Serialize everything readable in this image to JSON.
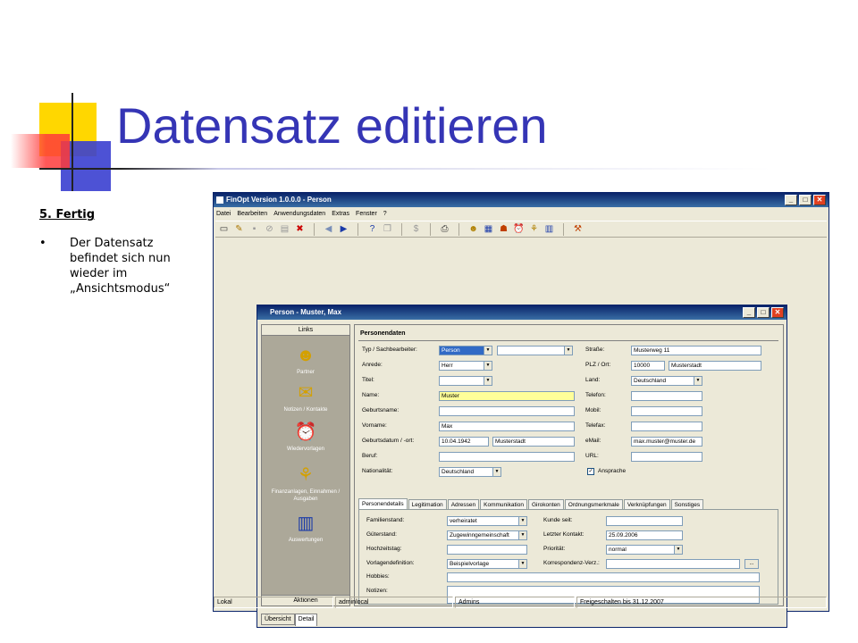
{
  "slide": {
    "title": "Datensatz editieren",
    "step": "5. Fertig",
    "bullet": "•",
    "bullet_text": "Der Datensatz befindet sich nun wieder im „Ansichtsmodus“"
  },
  "app": {
    "title": "FinOpt Version 1.0.0.0 - Person",
    "menu": [
      "Datei",
      "Bearbeiten",
      "Anwendungsdaten",
      "Extras",
      "Fenster",
      "?"
    ],
    "win_minimize": "_",
    "win_maximize": "□",
    "win_close": "✕",
    "status": [
      "Lokal",
      "adminlocal",
      "Admins",
      "Freigeschalten bis 31.12.2007"
    ]
  },
  "inner": {
    "title": "Person - Muster, Max",
    "left_header": "Links",
    "left_footer": "Aktionen",
    "nav": [
      "Partner",
      "Notizen / Kontakte",
      "Wiedervorlagen",
      "Finanzanlagen, Einnahmen / Ausgaben",
      "Auswertungen"
    ],
    "bottom_tabs": [
      "Übersicht",
      "Detail"
    ]
  },
  "form": {
    "section": "Personendaten",
    "typ_label": "Typ / Sachbearbeiter:",
    "typ_value": "Person",
    "sachbearbeiter_value": "",
    "anrede_label": "Anrede:",
    "anrede_value": "Herr",
    "titel_label": "Titel:",
    "titel_value": "",
    "name_label": "Name:",
    "name_value": "Muster",
    "geburtsname_label": "Geburtsname:",
    "geburtsname_value": "",
    "vorname_label": "Vorname:",
    "vorname_value": "Max",
    "geburtsdatum_label": "Geburtsdatum / -ort:",
    "geburtsdatum_value": "10.04.1942",
    "geburtsort_value": "Musterstadt",
    "beruf_label": "Beruf:",
    "beruf_value": "",
    "nationalitaet_label": "Nationalität:",
    "nationalitaet_value": "Deutschland",
    "strasse_label": "Straße:",
    "strasse_value": "Musterweg 11",
    "plz_label": "PLZ / Ort:",
    "plz_value": "10000",
    "ort_value": "Musterstadt",
    "land_label": "Land:",
    "land_value": "Deutschland",
    "telefon_label": "Telefon:",
    "telefon_value": "",
    "mobil_label": "Mobil:",
    "mobil_value": "",
    "telefax_label": "Telefax:",
    "telefax_value": "",
    "email_label": "eMail:",
    "email_value": "max.muster@muster.de",
    "url_label": "URL:",
    "url_value": "",
    "ansprache_label": "Ansprache",
    "ansprache_check": "✓",
    "tabs": [
      "Personendetails",
      "Legitimation",
      "Adressen",
      "Kommunikation",
      "Girokonten",
      "Ordnungsmerkmale",
      "Verknüpfungen",
      "Sonstiges"
    ],
    "familienstand_label": "Familienstand:",
    "familienstand_value": "verheiratet",
    "gueterstand_label": "Güterstand:",
    "gueterstand_value": "Zugewinngemeinschaft",
    "hochzeitstag_label": "Hochzeitstag:",
    "hochzeitstag_value": "",
    "vorlagendefinition_label": "Vorlagendefinition:",
    "vorlagendefinition_value": "Beispielvorlage",
    "hobbies_label": "Hobbies:",
    "hobbies_value": "",
    "notizen_label": "Notizen:",
    "notizen_value": "",
    "kunde_seit_label": "Kunde seit:",
    "kunde_seit_value": "",
    "letzter_kontakt_label": "Letzter Kontakt:",
    "letzter_kontakt_value": "25.09.2006",
    "prioritaet_label": "Priorität:",
    "prioritaet_value": "normal",
    "korrespondenz_label": "Korrespondenz-Verz.:",
    "korrespondenz_value": "",
    "browse_label": "..."
  }
}
